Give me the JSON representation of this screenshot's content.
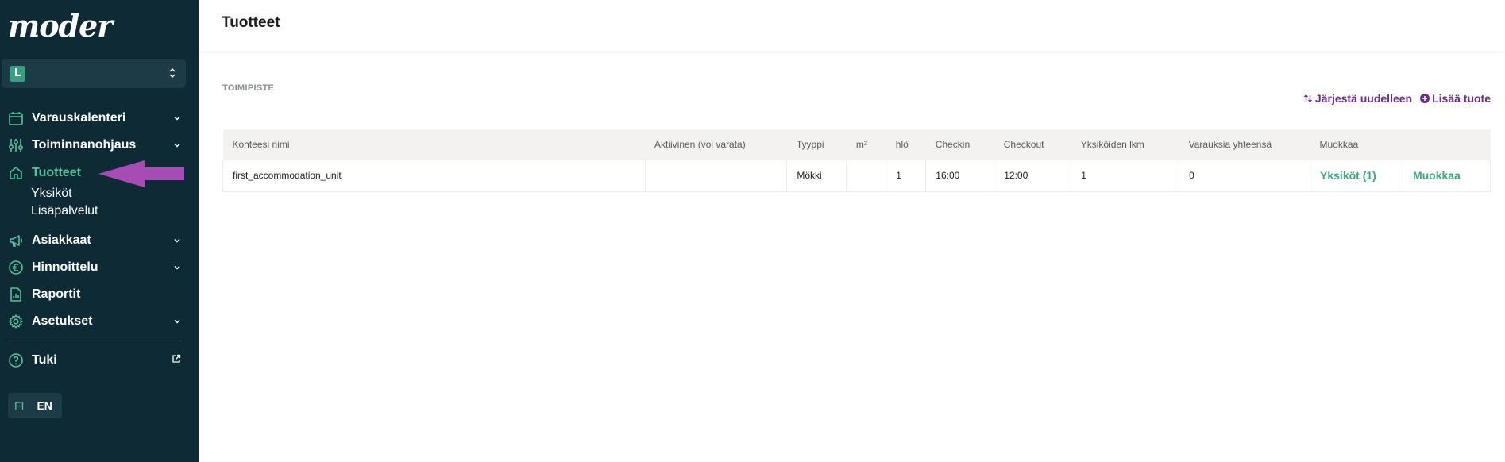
{
  "app": {
    "logo": "moder"
  },
  "org_select": {
    "initial": "L"
  },
  "sidebar": {
    "items": [
      {
        "label": "Varauskalenteri",
        "icon": "calendar-icon",
        "chevron": true
      },
      {
        "label": "Toiminnanohjaus",
        "icon": "sliders-icon",
        "chevron": true
      },
      {
        "label": "Tuotteet",
        "icon": "home-icon",
        "active": true,
        "sub": [
          "Yksiköt",
          "Lisäpalvelut"
        ]
      },
      {
        "label": "Asiakkaat",
        "icon": "megaphone-icon",
        "chevron": true
      },
      {
        "label": "Hinnoittelu",
        "icon": "euro-icon",
        "chevron": true
      },
      {
        "label": "Raportit",
        "icon": "report-icon"
      },
      {
        "label": "Asetukset",
        "icon": "gear-icon",
        "chevron": true
      },
      {
        "label": "Tuki",
        "icon": "help-icon",
        "external": true
      }
    ]
  },
  "language": {
    "fi": "FI",
    "en": "EN",
    "selected": "FI"
  },
  "header": {
    "title": "Tuotteet"
  },
  "section": {
    "label": "TOIMIPISTE"
  },
  "actions": {
    "reorder": "Järjestä uudelleen",
    "add": "Lisää tuote"
  },
  "table": {
    "columns": [
      "Kohteesi nimi",
      "Aktiivinen (voi varata)",
      "Tyyppi",
      "m²",
      "hlö",
      "Checkin",
      "Checkout",
      "Yksiköiden lkm",
      "Varauksia yhteensä",
      "Muokkaa"
    ],
    "rows": [
      {
        "name": "first_accommodation_unit",
        "active": "",
        "type": "Mökki",
        "m2": "",
        "persons": "1",
        "checkin": "16:00",
        "checkout": "12:00",
        "units": "1",
        "bookings": "0",
        "units_link": "Yksiköt (1)",
        "edit_link": "Muokkaa"
      }
    ]
  },
  "colors": {
    "sidebar_bg": "#0e2a35",
    "accent_green": "#55c39a",
    "link_green": "#3aa87b",
    "action_purple": "#6a2b8c",
    "annotation_arrow": "#a64cb4"
  }
}
